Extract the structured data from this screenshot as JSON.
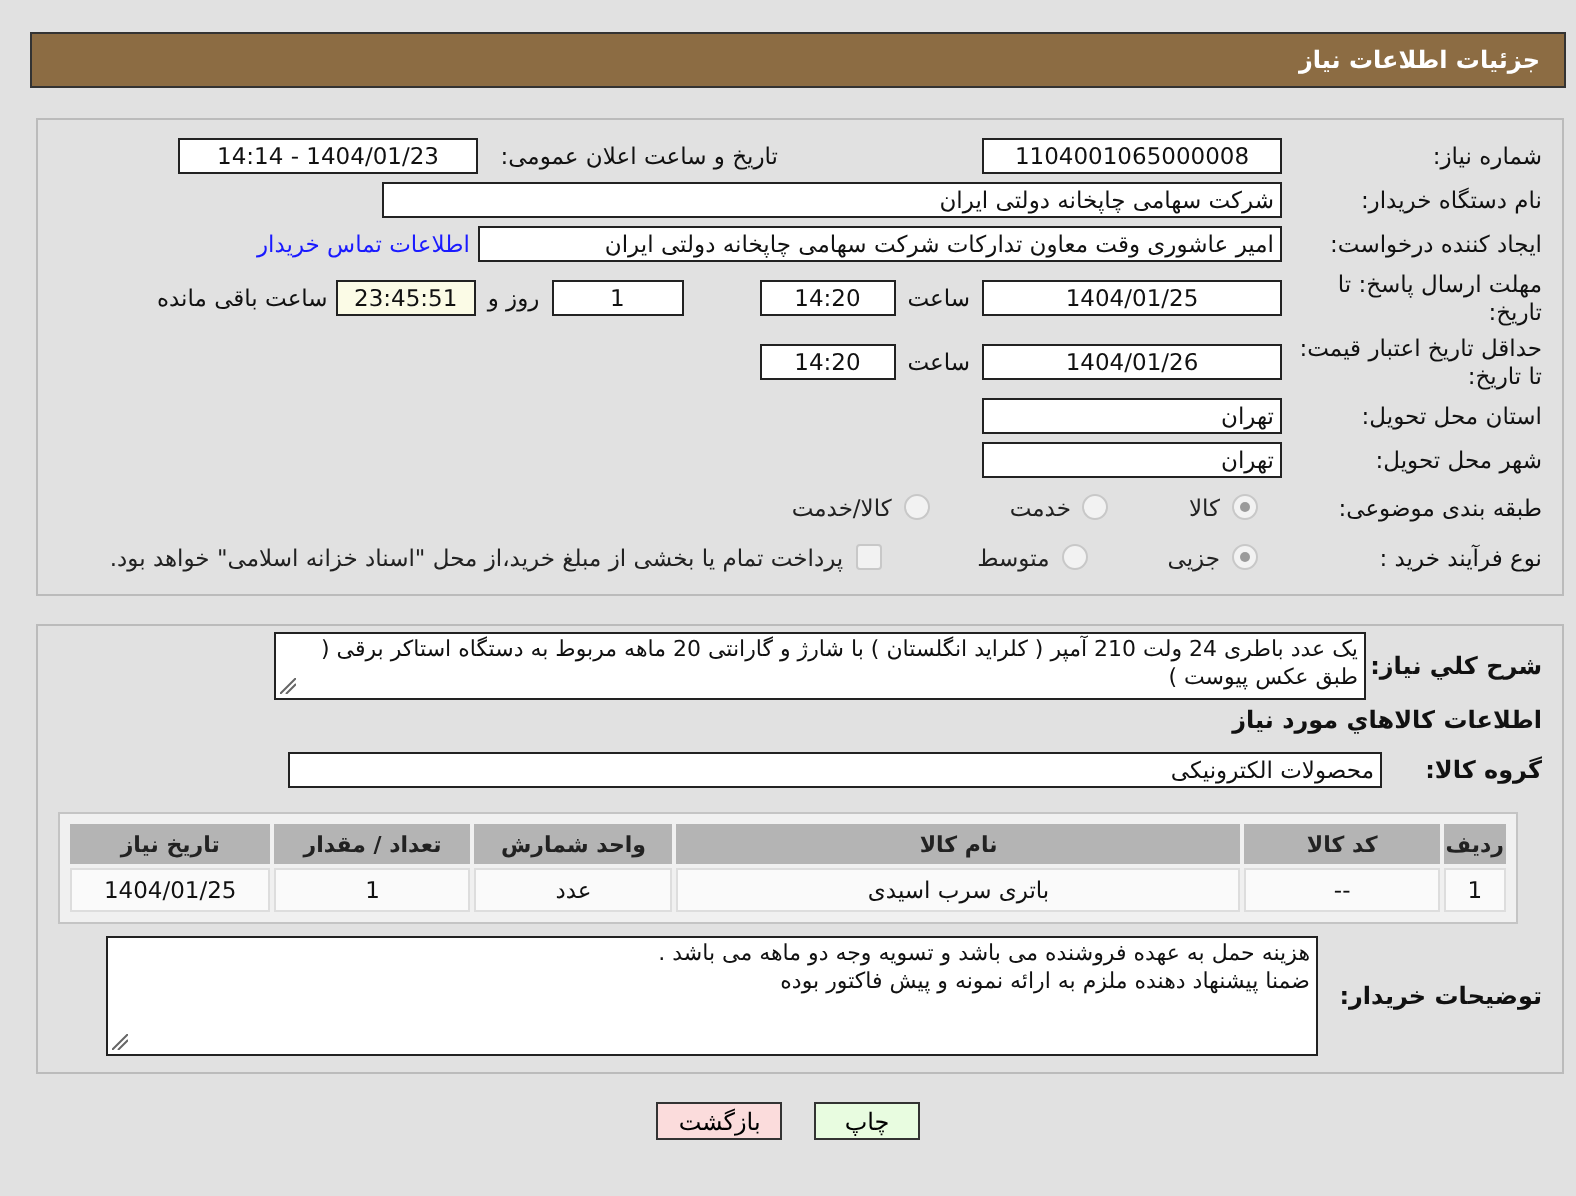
{
  "header": {
    "title": "جزئیات اطلاعات نیاز"
  },
  "need_info": {
    "need_number": {
      "label": "شماره نیاز:",
      "value": "1104001065000008"
    },
    "announce": {
      "label": "تاریخ و ساعت اعلان عمومی:",
      "value": "1404/01/23 - 14:14"
    },
    "buyer_org": {
      "label": "نام دستگاه خریدار:",
      "value": "شرکت سهامی چاپخانه دولتی ایران"
    },
    "requester": {
      "label": "ایجاد کننده درخواست:",
      "value": "امیر عاشوری وقت معاون تدارکات شرکت سهامی چاپخانه دولتی ایران",
      "contact_link": "اطلاعات تماس خریدار"
    },
    "deadline": {
      "label": "مهلت ارسال پاسخ: تا تاریخ:",
      "date": "1404/01/25",
      "time_label": "ساعت",
      "time": "14:20",
      "days": "1",
      "days_label": "روز و",
      "remaining": "23:45:51",
      "remaining_label": "ساعت باقی مانده"
    },
    "price_validity": {
      "label": "حداقل تاریخ اعتبار قیمت: تا تاریخ:",
      "date": "1404/01/26",
      "time_label": "ساعت",
      "time": "14:20"
    },
    "province": {
      "label": "استان محل تحویل:",
      "value": "تهران"
    },
    "city": {
      "label": "شهر محل تحویل:",
      "value": "تهران"
    },
    "category": {
      "label": "طبقه بندی موضوعی:",
      "options": [
        {
          "label": "کالا",
          "selected": true
        },
        {
          "label": "خدمت",
          "selected": false
        },
        {
          "label": "کالا/خدمت",
          "selected": false
        }
      ]
    },
    "process": {
      "label": "نوع فرآیند خرید :",
      "options": [
        {
          "label": "جزیی",
          "selected": true
        },
        {
          "label": "متوسط",
          "selected": false
        }
      ],
      "payment_note": {
        "label": "پرداخت تمام یا بخشی از مبلغ خرید،از محل \"اسناد خزانه اسلامی\" خواهد بود.",
        "checked": false
      }
    }
  },
  "goods": {
    "description": {
      "label": "شرح کلي نياز:",
      "value": "یک عدد باطری 24 ولت 210 آمپر ( کلراید انگلستان ) با شارژ و گارانتی 20 ماهه مربوط به دستگاه استاکر برقی ( طبق عکس پیوست )"
    },
    "heading": "اطلاعات كالاهاي مورد نياز",
    "group": {
      "label": "گروه کالا:",
      "value": "محصولات الکترونیکی"
    },
    "table": {
      "columns": [
        "ردیف",
        "کد کالا",
        "نام کالا",
        "واحد شمارش",
        "تعداد / مقدار",
        "تاریخ نیاز"
      ],
      "rows": [
        [
          "1",
          "--",
          "باتری سرب اسیدی",
          "عدد",
          "1",
          "1404/01/25"
        ]
      ]
    },
    "notes": {
      "label": "توضیحات خریدار:",
      "value": "هزینه حمل به عهده فروشنده می باشد و تسویه وجه دو ماهه می باشد .\nضمنا پیشنهاد دهنده ملزم به ارائه نمونه و پیش فاکتور بوده"
    }
  },
  "buttons": [
    {
      "kind": "print",
      "label": "چاپ"
    },
    {
      "kind": "back",
      "label": "بازگشت"
    }
  ]
}
